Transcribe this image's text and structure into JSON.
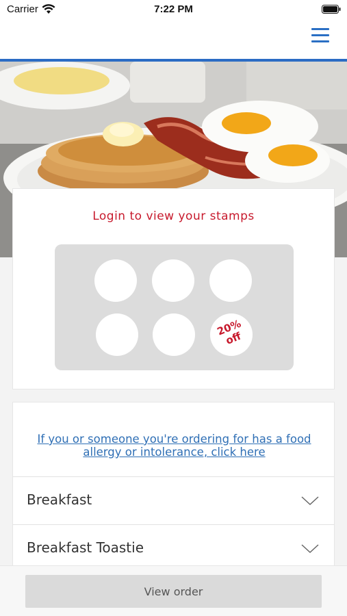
{
  "status_bar": {
    "carrier": "Carrier",
    "time": "7:22 PM"
  },
  "nav": {
    "menu_icon": "hamburger-icon",
    "accent_color": "#2b6cc4"
  },
  "stamps": {
    "title": "Login to view your stamps",
    "title_color": "#c7192c",
    "total": 6,
    "collected": 0,
    "reward_line1": "20%",
    "reward_line2": "off"
  },
  "allergy": {
    "link_text": "If you or someone you're ordering for has a food allergy or intolerance, click here",
    "link_color": "#2f6fb5"
  },
  "menu": {
    "categories": [
      {
        "label": "Breakfast"
      },
      {
        "label": "Breakfast Toastie"
      }
    ],
    "chevron_icon": "chevron-down-icon"
  },
  "footer": {
    "view_order_label": "View order"
  }
}
